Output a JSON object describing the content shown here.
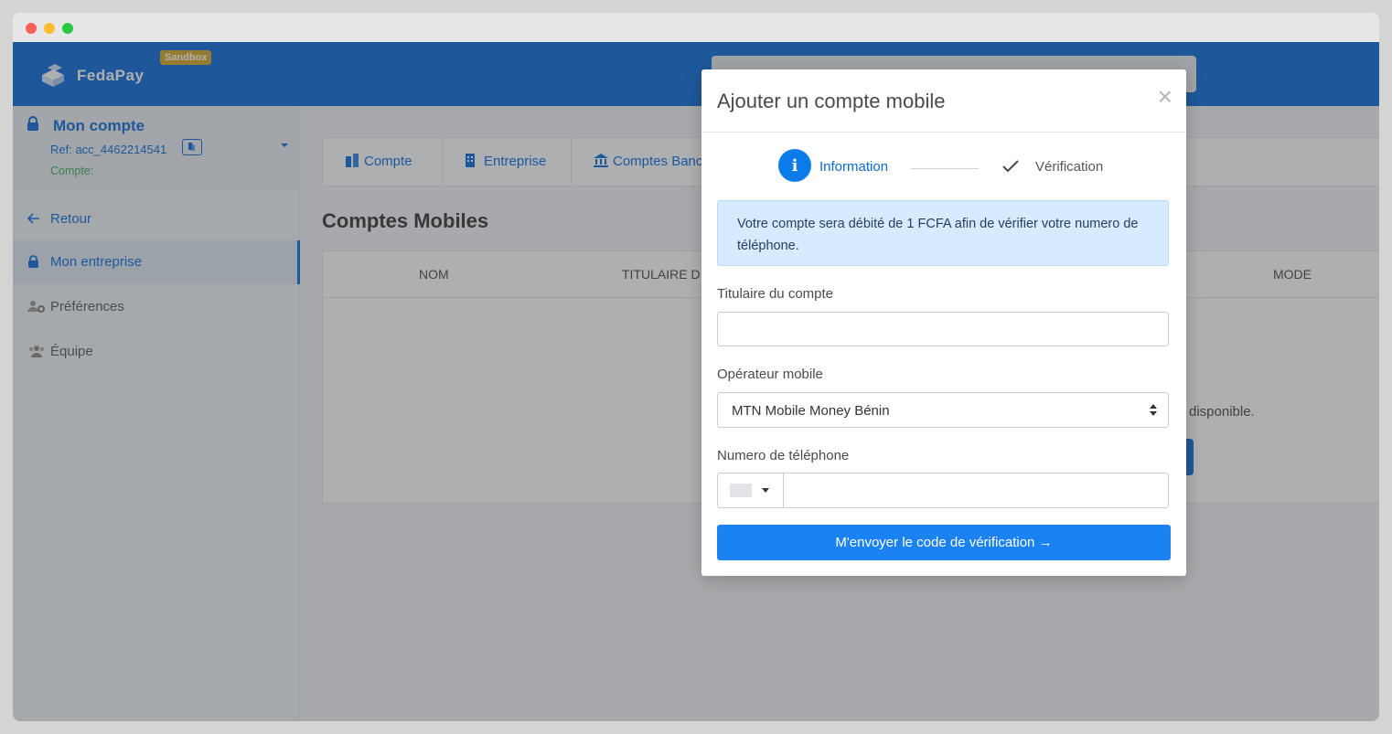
{
  "app": {
    "brand": "FedaPay",
    "badge": "Sandbox"
  },
  "sidebar": {
    "account": {
      "title": "Mon compte",
      "ref": "Ref: acc_4462214541",
      "compte_label": "Compte:"
    },
    "items": [
      {
        "label": "Retour",
        "icon": "arrow-left-icon"
      },
      {
        "label": "Mon entreprise",
        "icon": "lock-icon",
        "active": true
      },
      {
        "label": "Préférences",
        "icon": "user-gear-icon"
      },
      {
        "label": "Équipe",
        "icon": "team-icon"
      }
    ]
  },
  "main": {
    "tabs": [
      {
        "label": "Compte",
        "icon": "building-icon"
      },
      {
        "label": "Entreprise",
        "icon": "office-icon"
      },
      {
        "label": "Comptes Banc",
        "icon": "bank-icon"
      }
    ],
    "section_title": "Comptes Mobiles",
    "table_headers": [
      "NOM",
      "TITULAIRE D",
      "MODE"
    ],
    "empty_text": "disponible."
  },
  "modal": {
    "title": "Ajouter un compte mobile",
    "close": "×",
    "steps": [
      {
        "number": "i",
        "label": "Information",
        "active": true
      },
      {
        "label": "Vérification",
        "icon": "check-icon"
      }
    ],
    "alert": "Votre compte sera débité de 1 FCFA afin de vérifier votre numero de téléphone.",
    "fields": {
      "titulaire_label": "Titulaire du compte",
      "titulaire_value": "",
      "operateur_label": "Opérateur mobile",
      "operateur_value": "MTN Mobile Money Bénin",
      "numero_label": "Numero de téléphone",
      "numero_value": ""
    },
    "submit": "M'envoyer le code de vérification →"
  },
  "colors": {
    "primary": "#0a6ad8",
    "button": "#1a82f3",
    "alert_bg": "#d7ebfe",
    "sandbox": "#d9a820",
    "compte_green": "#3aa757"
  }
}
